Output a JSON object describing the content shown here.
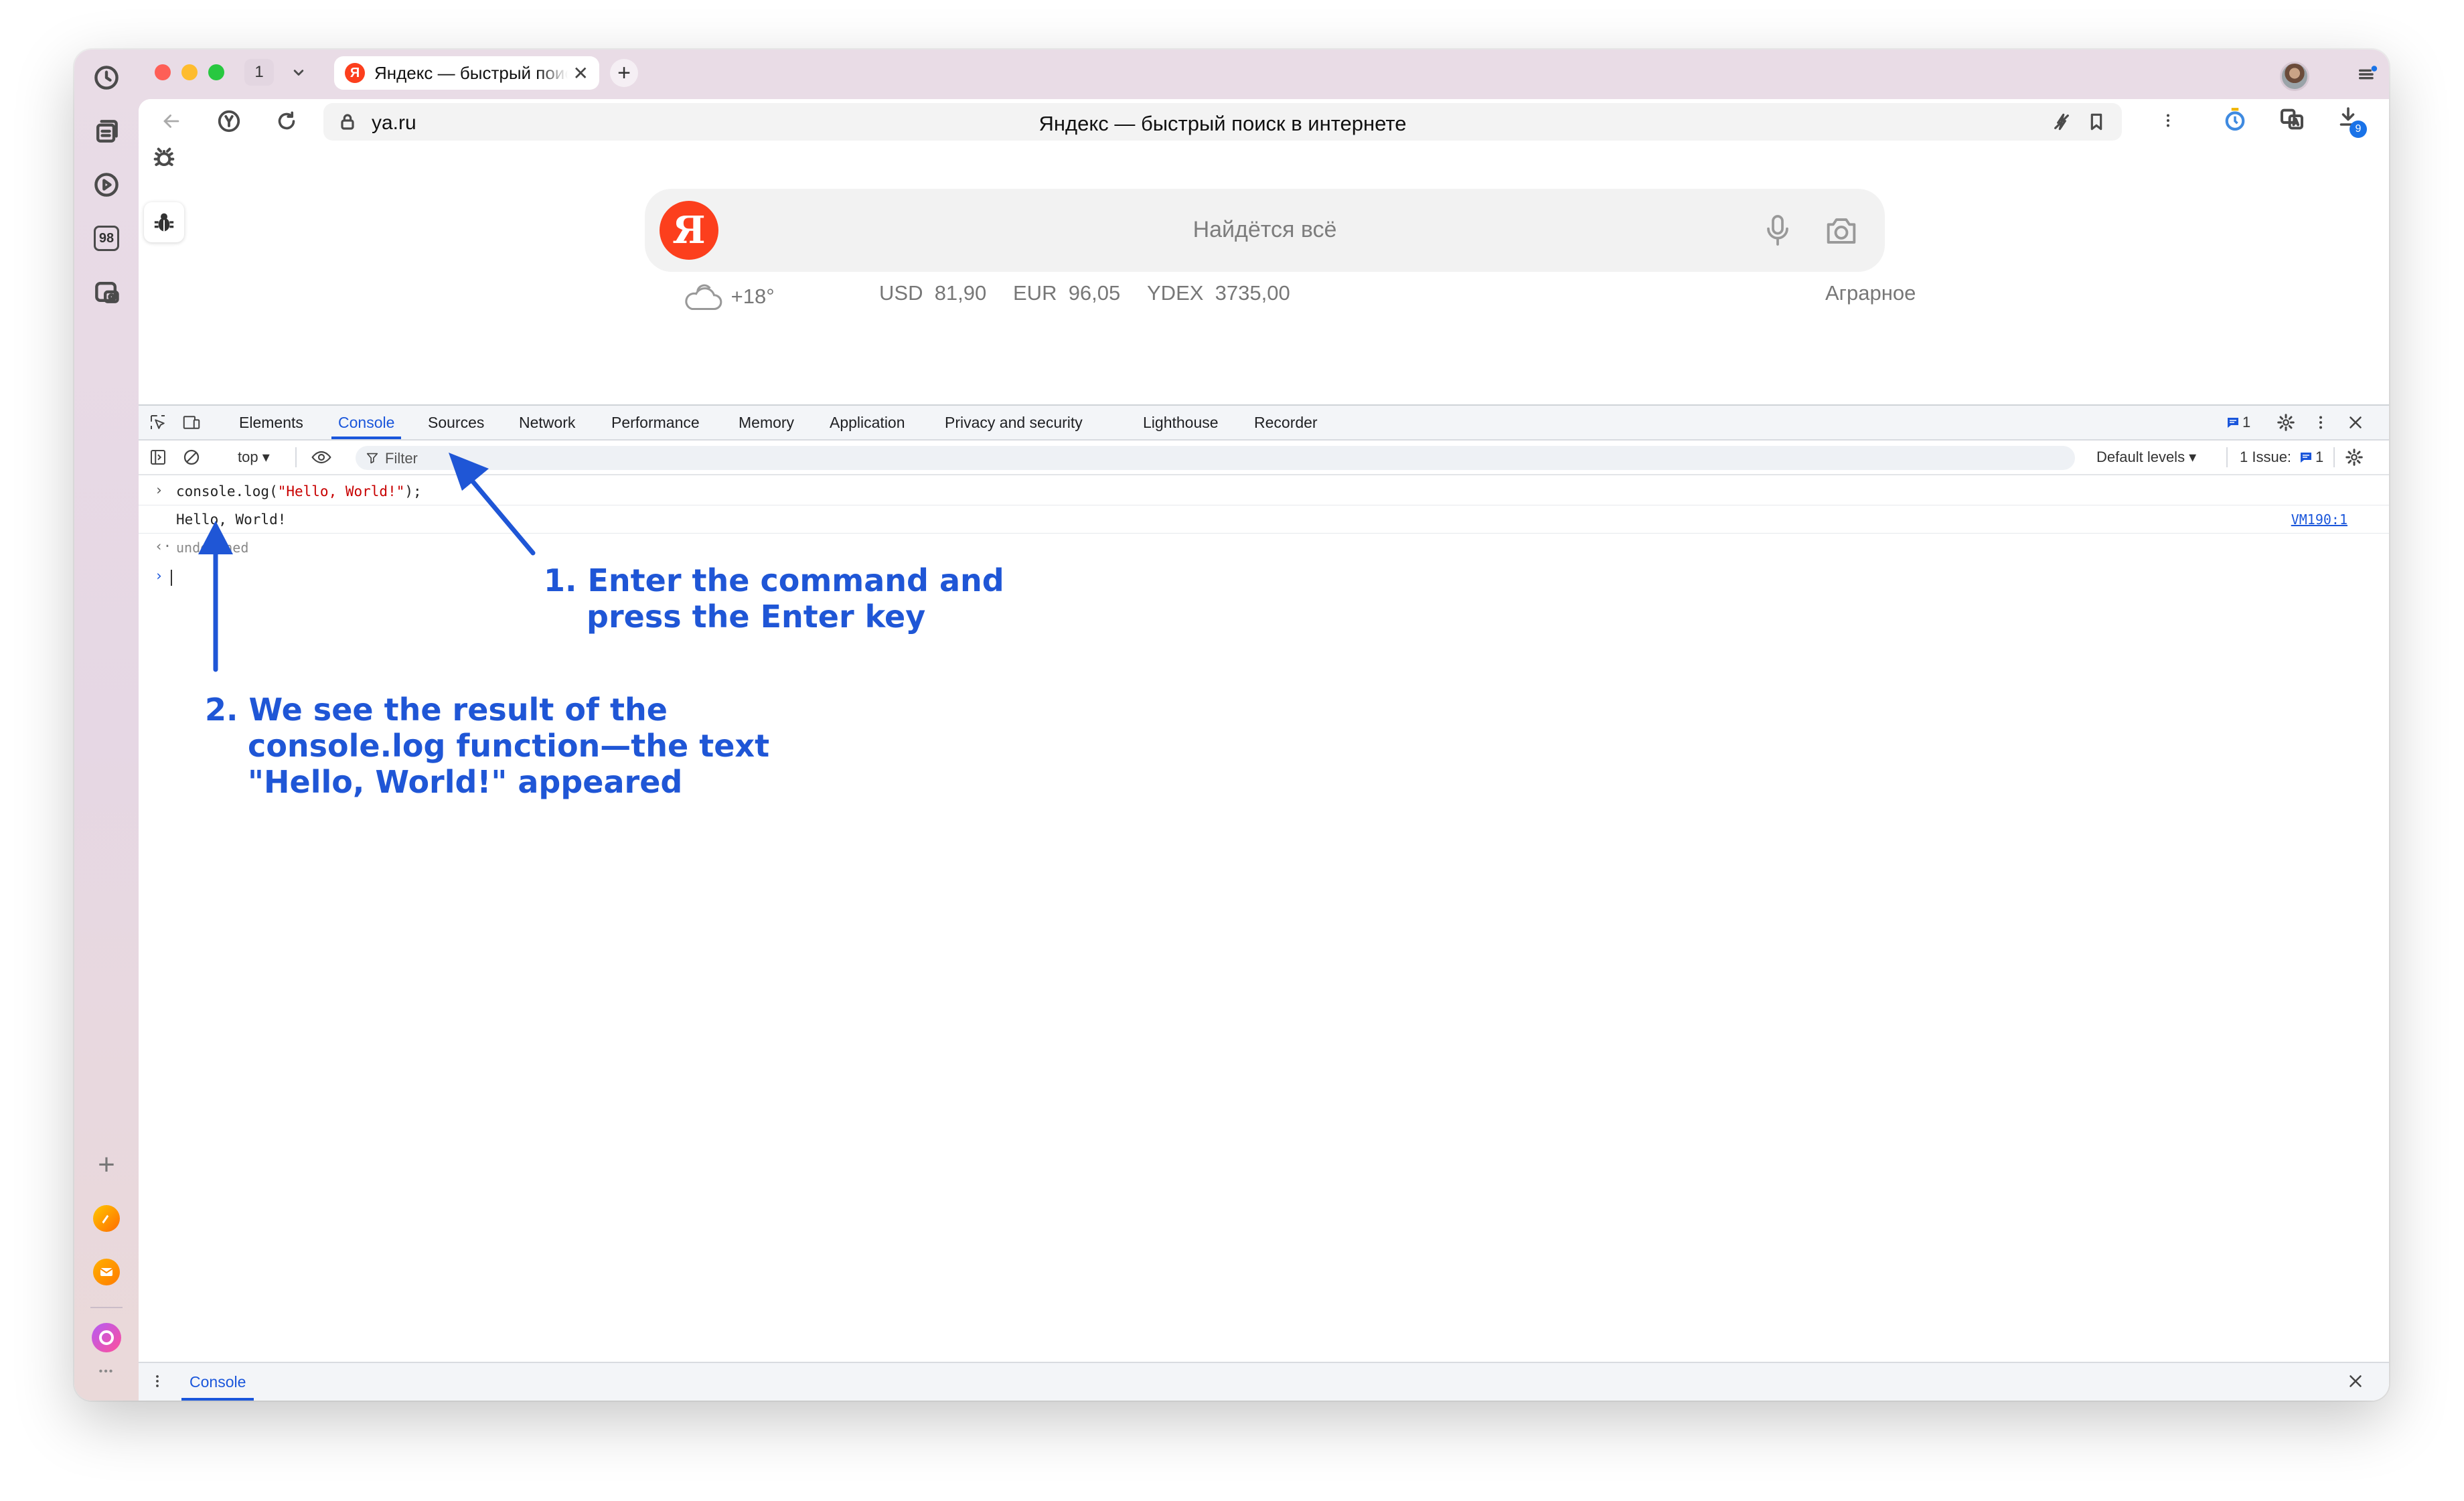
{
  "tabbar": {
    "tab_count": "1",
    "tab": {
      "favicon": "Я",
      "title": "Яндекс — быстрый поиск в интернете",
      "close": "✕"
    },
    "new_tab": "+"
  },
  "address_bar": {
    "url": "ya.ru",
    "page_title": "Яндекс — быстрый поиск в интернете",
    "downloads_badge": "9"
  },
  "sidebar": {
    "badge_98": "98",
    "add": "+",
    "more": "•••"
  },
  "page": {
    "search_placeholder": "Найдётся всё",
    "logo": "Я",
    "weather": "+18°",
    "usd_label": "USD",
    "usd_value": "81,90",
    "eur_label": "EUR",
    "eur_value": "96,05",
    "ydex_label": "YDEX",
    "ydex_value": "3735,00",
    "location": "Аграрное"
  },
  "devtools": {
    "tabs": [
      "Elements",
      "Console",
      "Sources",
      "Network",
      "Performance",
      "Memory",
      "Application",
      "Privacy and security",
      "Lighthouse",
      "Recorder"
    ],
    "active_tab": "Console",
    "messages_badge": "1",
    "toolbar": {
      "context": "top ▾",
      "filter_placeholder": "Filter",
      "levels": "Default levels ▾",
      "issues_label": "1 Issue:",
      "issues_count": "1"
    },
    "console": {
      "command_prefix": "console.log(",
      "command_string": "\"Hello, World!\"",
      "command_suffix": ");",
      "output": "Hello, World!",
      "output_source": "VM190:1",
      "return_value": "undefined"
    },
    "drawer_tab": "Console"
  },
  "annotations": {
    "step1": "1. Enter the command and\n    press the Enter key",
    "step2": "2. We see the result of the\n    console.log function—the text\n    \"Hello, World!\" appeared"
  },
  "colors": {
    "accent": "#1a56db",
    "annotation": "#1f56d6",
    "yandex_red": "#fc3f1d",
    "console_string": "#c80000"
  }
}
